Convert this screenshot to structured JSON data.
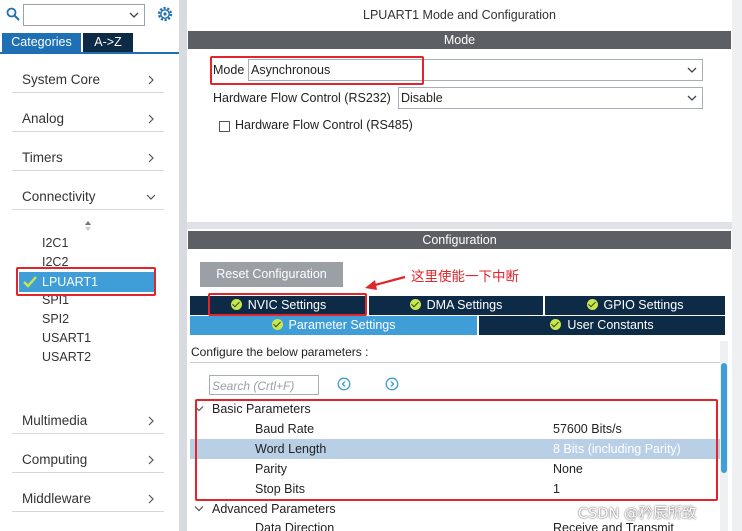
{
  "left_panel": {
    "tabs": {
      "categories": "Categories",
      "az": "A->Z"
    },
    "categories": [
      {
        "label": "System Core",
        "arrow": "chevron-right-icon"
      },
      {
        "label": "Analog",
        "arrow": "chevron-right-icon"
      },
      {
        "label": "Timers",
        "arrow": "chevron-right-icon"
      },
      {
        "label": "Connectivity",
        "arrow": "chevron-down-icon"
      }
    ],
    "connectivity_items": [
      "I2C1",
      "I2C2",
      "LPUART1",
      "SPI1",
      "SPI2",
      "USART1",
      "USART2"
    ],
    "selected_item": "LPUART1",
    "bottom_categories": [
      {
        "label": "Multimedia"
      },
      {
        "label": "Computing"
      },
      {
        "label": "Middleware"
      }
    ]
  },
  "main": {
    "title": "LPUART1 Mode and Configuration",
    "mode_bar": "Mode",
    "mode": {
      "mode_label": "Mode",
      "mode_value": "Asynchronous",
      "hfc232_label": "Hardware Flow Control (RS232)",
      "hfc232_value": "Disable",
      "hfc485_label": "Hardware Flow Control (RS485)"
    },
    "config_bar": "Configuration",
    "reset_button": "Reset Configuration",
    "annotation": "这里使能一下中断",
    "tabs_row1": [
      "NVIC Settings",
      "DMA Settings",
      "GPIO Settings"
    ],
    "tabs_row2": [
      "Parameter Settings",
      "User Constants"
    ],
    "configure_text": "Configure the below parameters :",
    "search_placeholder": "Search (Crtl+F)",
    "groups": {
      "basic": "Basic Parameters",
      "advanced": "Advanced Parameters"
    },
    "basic_params": [
      {
        "name": "Baud Rate",
        "value": "57600 Bits/s"
      },
      {
        "name": "Word Length",
        "value": "8 Bits (including Parity)"
      },
      {
        "name": "Parity",
        "value": "None"
      },
      {
        "name": "Stop Bits",
        "value": "1"
      }
    ],
    "advanced_params": [
      {
        "name": "Data Direction",
        "value": "Receive and Transmit"
      }
    ]
  },
  "watermark": "CSDN @矜辰所致",
  "colors": {
    "accent_blue": "#3f9ed8",
    "navy": "#0d2b46",
    "highlight_red": "#e0252b"
  }
}
